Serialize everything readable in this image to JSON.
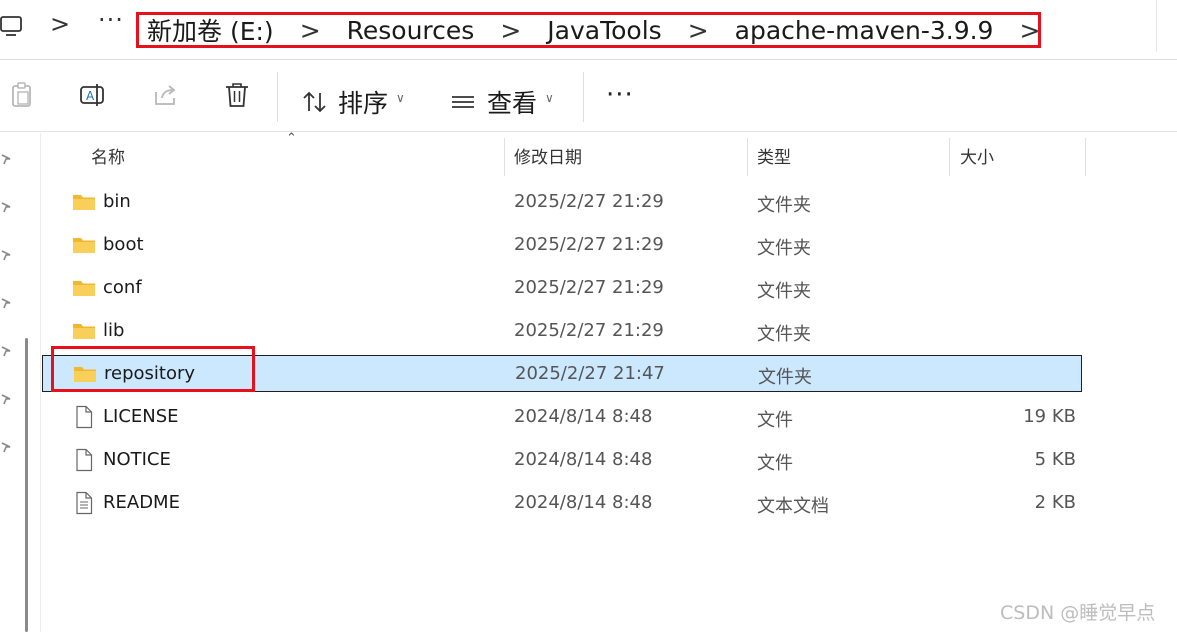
{
  "breadcrumb": {
    "items": [
      "新加卷 (E:)",
      "Resources",
      "JavaTools",
      "apache-maven-3.9.9"
    ],
    "separator": ">",
    "more": "···",
    "nav_chevron": ">"
  },
  "toolbar": {
    "icons": [
      "clipboard-icon",
      "rename-icon",
      "share-icon",
      "trash-icon"
    ],
    "sort_label": "排序",
    "view_label": "查看",
    "more": "···"
  },
  "columns": {
    "name": "名称",
    "date": "修改日期",
    "type": "类型",
    "size": "大小"
  },
  "files": [
    {
      "name": "bin",
      "date": "2025/2/27 21:29",
      "type": "文件夹",
      "size": "",
      "icon": "folder-icon",
      "selected": false
    },
    {
      "name": "boot",
      "date": "2025/2/27 21:29",
      "type": "文件夹",
      "size": "",
      "icon": "folder-icon",
      "selected": false
    },
    {
      "name": "conf",
      "date": "2025/2/27 21:29",
      "type": "文件夹",
      "size": "",
      "icon": "folder-icon",
      "selected": false
    },
    {
      "name": "lib",
      "date": "2025/2/27 21:29",
      "type": "文件夹",
      "size": "",
      "icon": "folder-icon",
      "selected": false
    },
    {
      "name": "repository",
      "date": "2025/2/27 21:47",
      "type": "文件夹",
      "size": "",
      "icon": "folder-icon",
      "selected": true
    },
    {
      "name": "LICENSE",
      "date": "2024/8/14 8:48",
      "type": "文件",
      "size": "19 KB",
      "icon": "file-icon",
      "selected": false
    },
    {
      "name": "NOTICE",
      "date": "2024/8/14 8:48",
      "type": "文件",
      "size": "5 KB",
      "icon": "file-icon",
      "selected": false
    },
    {
      "name": "README",
      "date": "2024/8/14 8:48",
      "type": "文本文档",
      "size": "2 KB",
      "icon": "text-file-icon",
      "selected": false
    }
  ],
  "watermark": "CSDN @睡觉早点",
  "colors": {
    "highlight_box": "#e8101a",
    "selection_bg": "#cce8ff",
    "folder": "#f8c94a"
  }
}
